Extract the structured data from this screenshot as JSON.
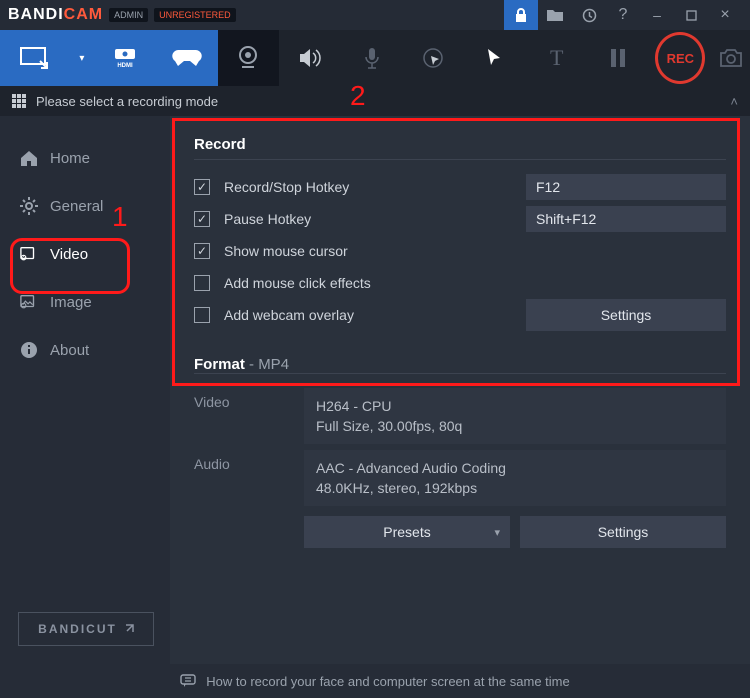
{
  "title": {
    "brand_a": "BANDI",
    "brand_b": "CAM",
    "badge_admin": "ADMIN",
    "badge_unreg": "UNREGISTERED"
  },
  "mode_select": {
    "label": "Please select a recording mode"
  },
  "annotations": {
    "one": "1",
    "two": "2"
  },
  "sidebar": {
    "items": [
      {
        "label": "Home"
      },
      {
        "label": "General"
      },
      {
        "label": "Video"
      },
      {
        "label": "Image"
      },
      {
        "label": "About"
      }
    ],
    "bandicut": "BANDICUT"
  },
  "record": {
    "title": "Record",
    "rows": [
      {
        "label": "Record/Stop Hotkey",
        "checked": true,
        "value": "F12"
      },
      {
        "label": "Pause Hotkey",
        "checked": true,
        "value": "Shift+F12"
      },
      {
        "label": "Show mouse cursor",
        "checked": true
      },
      {
        "label": "Add mouse click effects",
        "checked": false
      },
      {
        "label": "Add webcam overlay",
        "checked": false
      }
    ],
    "settings_btn": "Settings"
  },
  "format": {
    "title": "Format",
    "codec": "MP4",
    "video_key": "Video",
    "video_line1": "H264 - CPU",
    "video_line2": "Full Size, 30.00fps, 80q",
    "audio_key": "Audio",
    "audio_line1": "AAC - Advanced Audio Coding",
    "audio_line2": "48.0KHz, stereo, 192kbps",
    "presets_btn": "Presets",
    "settings_btn": "Settings"
  },
  "footer": {
    "tip": "How to record your face and computer screen at the same time"
  },
  "rec_button": "REC"
}
